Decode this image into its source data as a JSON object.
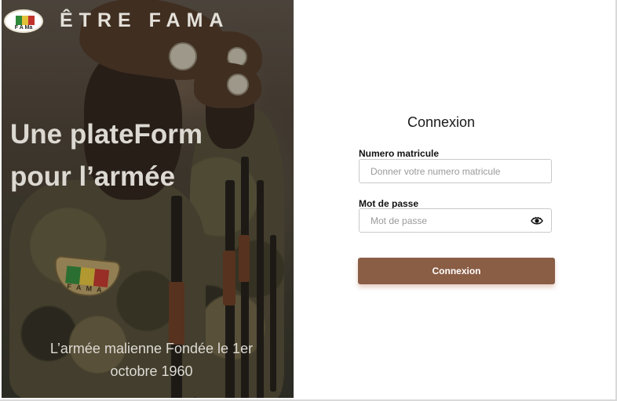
{
  "hero": {
    "logo_text": "F A Ma",
    "brand": "ÊTRE FAMA",
    "headline_line1": "Une plateForm",
    "headline_line2": "pour l’armée",
    "subline_line1": "L’armée malienne Fondée le 1er",
    "subline_line2": "octobre 1960",
    "patch_text": "F A M A"
  },
  "login": {
    "title": "Connexion",
    "matricule_label": "Numero matricule",
    "matricule_placeholder": "Donner votre numero matricule",
    "matricule_value": "",
    "password_label": "Mot de passe",
    "password_placeholder": "Mot de passe",
    "password_value": "",
    "password_toggle_icon": "eye-icon",
    "submit_label": "Connexion"
  },
  "colors": {
    "accent": "#8a5d45",
    "flag_green": "#2f8a3a",
    "flag_yellow": "#e2c23a",
    "flag_red": "#c0342b"
  }
}
